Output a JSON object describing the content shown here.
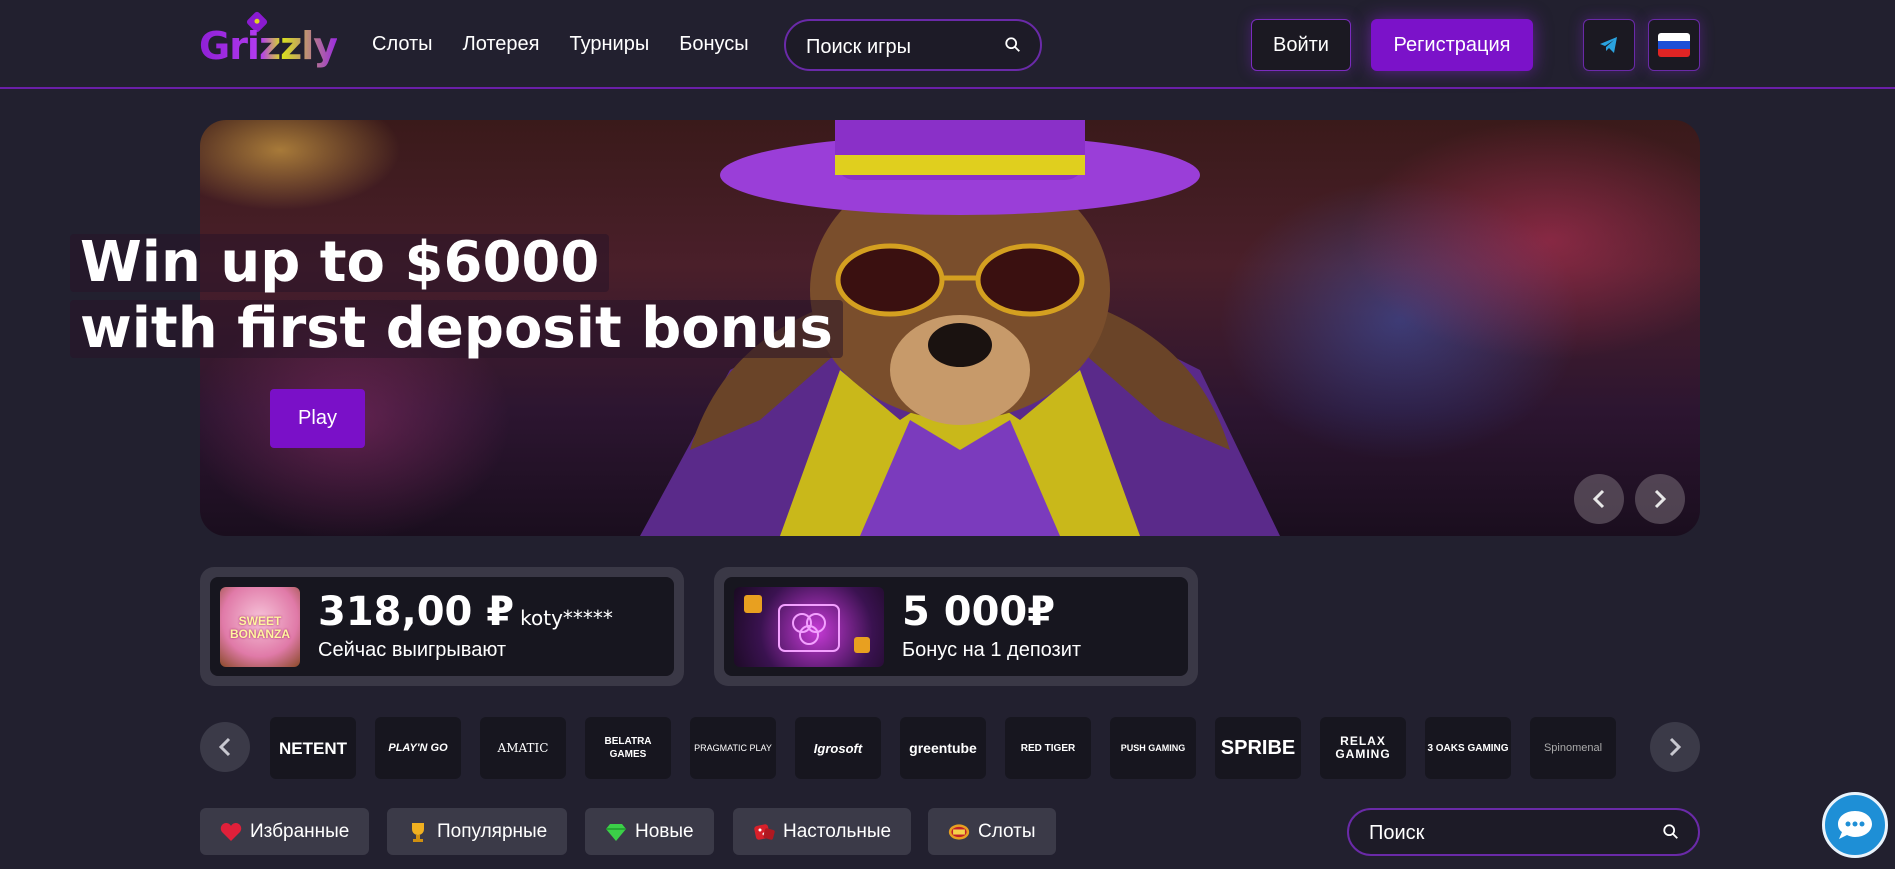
{
  "header": {
    "logo_text": "Grizzly",
    "nav": [
      {
        "label": "Слоты"
      },
      {
        "label": "Лотерея"
      },
      {
        "label": "Турниры"
      },
      {
        "label": "Бонусы"
      }
    ],
    "search_placeholder": "Поиск игры",
    "login_label": "Войти",
    "register_label": "Регистрация",
    "telegram_icon": "telegram-icon",
    "language_flag": "russian-flag-icon"
  },
  "hero": {
    "line1": "Win up to $6000",
    "line2": "with first deposit bonus",
    "cta_label": "Play"
  },
  "cards": [
    {
      "amount": "318,00 ₽",
      "user": "koty*****",
      "label": "Сейчас выигрывают",
      "thumb_text": "SWEET BONANZA"
    },
    {
      "amount": "5 000₽",
      "label": "Бонус на 1 депозит"
    }
  ],
  "providers": [
    "NETENT",
    "PLAY'N GO",
    "AMATIC",
    "BELATRA GAMES",
    "PRAGMATIC PLAY",
    "Igrosoft",
    "greentube",
    "RED TIGER",
    "PUSH GAMING",
    "SPRIBE",
    "RELAX GAMING",
    "3 OAKS GAMING",
    "Spinomenal"
  ],
  "categories": [
    {
      "label": "Избранные",
      "icon": "heart-icon"
    },
    {
      "label": "Популярные",
      "icon": "trophy-icon"
    },
    {
      "label": "Новые",
      "icon": "gem-icon"
    },
    {
      "label": "Настольные",
      "icon": "dice-icon"
    },
    {
      "label": "Слоты",
      "icon": "bar-icon"
    }
  ],
  "bottom_search_placeholder": "Поиск",
  "colors": {
    "background": "#22202f",
    "accent": "#7b12c9",
    "border_accent": "#6a2aa8",
    "chat": "#1e8fd6"
  }
}
